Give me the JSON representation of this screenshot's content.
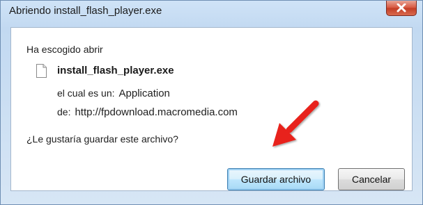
{
  "window": {
    "title": "Abriendo install_flash_player.exe",
    "close_icon": "close-icon"
  },
  "dialog": {
    "heading": "Ha escogido abrir",
    "file_icon": "file-icon",
    "file_name": "install_flash_player.exe",
    "type_label": "el cual es un:",
    "type_value": "Application",
    "from_label": "de:",
    "from_value": "http://fpdownload.macromedia.com",
    "question": "¿Le gustaría guardar este archivo?"
  },
  "buttons": {
    "save_label": "Guardar archivo",
    "cancel_label": "Cancelar"
  },
  "annotation": {
    "arrow_icon": "red-arrow-icon",
    "arrow_color": "#e8231a"
  }
}
